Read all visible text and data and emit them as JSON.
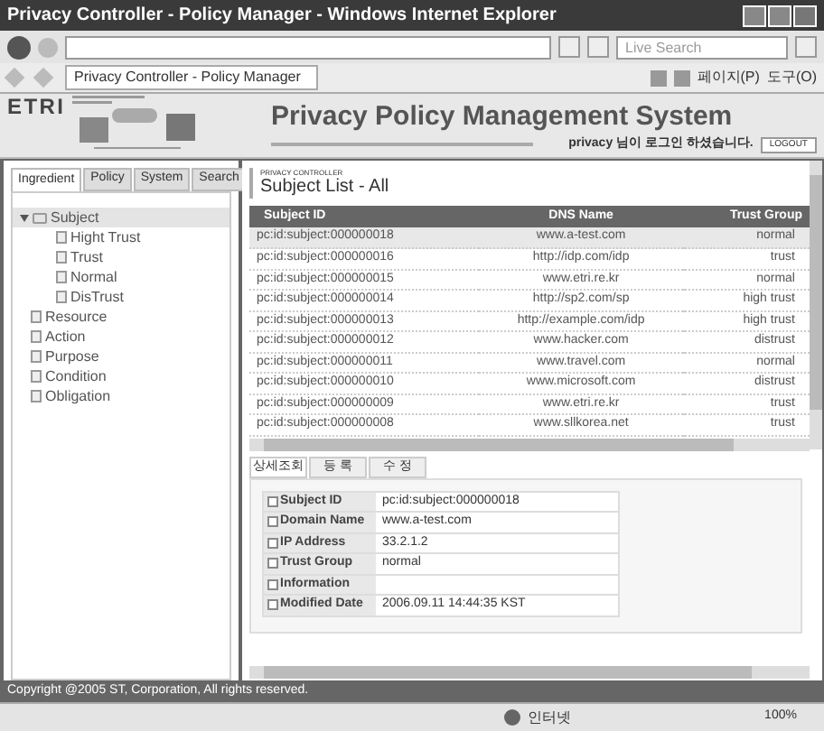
{
  "window": {
    "title": "Privacy Controller - Policy Manager - Windows Internet Explorer"
  },
  "address_bar": {
    "search_placeholder": "Live Search"
  },
  "browser_tab": {
    "label": "Privacy Controller - Policy Manager"
  },
  "toolbar": {
    "page_menu": "페이지(P)",
    "tools_menu": "도구(O)"
  },
  "banner": {
    "logo": "ETRI",
    "title": "Privacy Policy Management System",
    "user_message": "privacy 님이 로그인 하셨습니다.",
    "logout": "LOGOUT"
  },
  "side_tabs": [
    {
      "label": "Ingredient",
      "selected": true
    },
    {
      "label": "Policy",
      "selected": false
    },
    {
      "label": "System",
      "selected": false
    },
    {
      "label": "Search",
      "selected": false
    }
  ],
  "tree": [
    {
      "label": "Subject",
      "kind": "folder",
      "expanded": true,
      "selected": true,
      "children": [
        {
          "label": "Hight Trust",
          "kind": "page",
          "selected": false
        },
        {
          "label": "Trust",
          "kind": "page",
          "selected": false
        },
        {
          "label": "Normal",
          "kind": "page",
          "selected": false
        },
        {
          "label": "DisTrust",
          "kind": "page",
          "selected": false
        }
      ]
    },
    {
      "label": "Resource",
      "kind": "page",
      "selected": false
    },
    {
      "label": "Action",
      "kind": "page",
      "selected": false
    },
    {
      "label": "Purpose",
      "kind": "page",
      "selected": false
    },
    {
      "label": "Condition",
      "kind": "page",
      "selected": false
    },
    {
      "label": "Obligation",
      "kind": "page",
      "selected": false
    }
  ],
  "content": {
    "breadcrumb": "PRIVACY CONTROLLER",
    "heading": "Subject List - All"
  },
  "table": {
    "columns": [
      "Subject ID",
      "DNS Name",
      "Trust Group"
    ],
    "rows": [
      {
        "cells": [
          "pc:id:subject:000000018",
          "www.a-test.com",
          "normal"
        ],
        "selected": true
      },
      {
        "cells": [
          "pc:id:subject:000000016",
          "http://idp.com/idp",
          "trust"
        ],
        "selected": false
      },
      {
        "cells": [
          "pc:id:subject:000000015",
          "www.etri.re.kr",
          "normal"
        ],
        "selected": false
      },
      {
        "cells": [
          "pc:id:subject:000000014",
          "http://sp2.com/sp",
          "high trust"
        ],
        "selected": false
      },
      {
        "cells": [
          "pc:id:subject:000000013",
          "http://example.com/idp",
          "high trust"
        ],
        "selected": false
      },
      {
        "cells": [
          "pc:id:subject:000000012",
          "www.hacker.com",
          "distrust"
        ],
        "selected": false
      },
      {
        "cells": [
          "pc:id:subject:000000011",
          "www.travel.com",
          "normal"
        ],
        "selected": false
      },
      {
        "cells": [
          "pc:id:subject:000000010",
          "www.microsoft.com",
          "distrust"
        ],
        "selected": false
      },
      {
        "cells": [
          "pc:id:subject:000000009",
          "www.etri.re.kr",
          "trust"
        ],
        "selected": false
      },
      {
        "cells": [
          "pc:id:subject:000000008",
          "www.sllkorea.net",
          "trust"
        ],
        "selected": false
      }
    ]
  },
  "detail_tabs": [
    {
      "label": "상세조회",
      "selected": true
    },
    {
      "label": "등 록",
      "selected": false
    },
    {
      "label": "수 정",
      "selected": false
    }
  ],
  "details": [
    {
      "label": "Subject ID",
      "value": "pc:id:subject:000000018"
    },
    {
      "label": "Domain Name",
      "value": "www.a-test.com"
    },
    {
      "label": "IP Address",
      "value": "33.2.1.2"
    },
    {
      "label": "Trust Group",
      "value": "normal"
    },
    {
      "label": "Information"
    },
    {
      "label": "Modified Date",
      "value": "2006.09.11 14:44:35 KST"
    }
  ],
  "footer": {
    "copyright": "Copyright @2005 ST, Corporation, All rights reserved."
  },
  "status_bar": {
    "zone": "인터넷",
    "zoom": "100%"
  }
}
